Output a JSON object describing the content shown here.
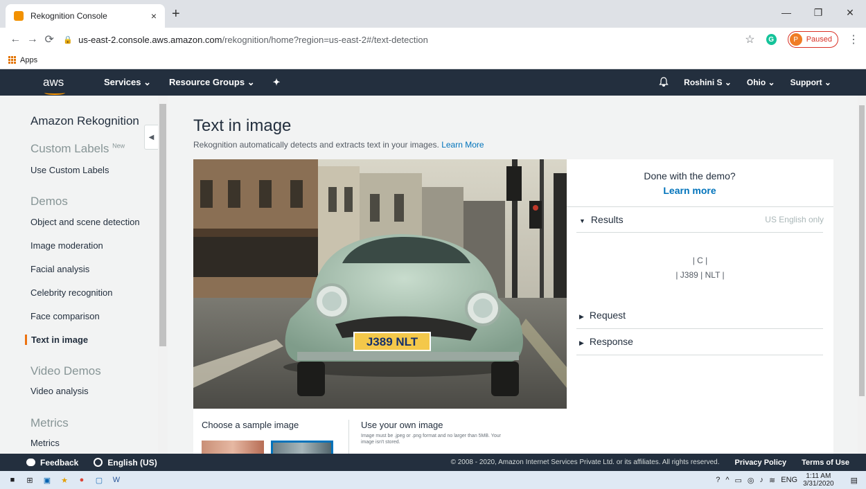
{
  "browser": {
    "tab_title": "Rekognition Console",
    "tab_close": "×",
    "new_tab": "+",
    "url_host": "us-east-2.console.aws.amazon.com",
    "url_path": "/rekognition/home?region=us-east-2#/text-detection",
    "profile_initial": "P",
    "profile_status": "Paused",
    "bookmark_apps": "Apps",
    "grammarly_letter": "G"
  },
  "aws_nav": {
    "logo": "aws",
    "services": "Services ⌄",
    "resource_groups": "Resource Groups ⌄",
    "pin": "✦",
    "bell": "🔔",
    "user": "Roshini S ⌄",
    "region": "Ohio ⌄",
    "support": "Support ⌄"
  },
  "sidebar": {
    "title": "Amazon Rekognition",
    "custom_labels_header": "Custom Labels",
    "new_badge": "New",
    "use_custom_labels": "Use Custom Labels",
    "demos_header": "Demos",
    "demos": [
      "Object and scene detection",
      "Image moderation",
      "Facial analysis",
      "Celebrity recognition",
      "Face comparison",
      "Text in image"
    ],
    "video_demos_header": "Video Demos",
    "video_analysis": "Video analysis",
    "metrics_header": "Metrics",
    "metrics": "Metrics"
  },
  "main": {
    "title": "Text in image",
    "subtitle": "Rekognition automatically detects and extracts text in your images.",
    "learn_more_link": "Learn More",
    "plate_text": "J389 NLT",
    "sample_header": "Choose a sample image",
    "own_image_header": "Use your own image",
    "own_image_note": "Image must be .jpeg or .png format and no larger than 5MB. Your image isn't stored."
  },
  "results": {
    "done_text": "Done with the demo?",
    "learn_more": "Learn more",
    "results_label": "Results",
    "results_note": "US English only",
    "detected_line1": "| C |",
    "detected_line2": "| J389 | NLT |",
    "request_label": "Request",
    "response_label": "Response"
  },
  "footer": {
    "feedback": "Feedback",
    "language": "English (US)",
    "copyright": "© 2008 - 2020, Amazon Internet Services Private Ltd. or its affiliates. All rights reserved.",
    "privacy": "Privacy Policy",
    "terms": "Terms of Use"
  },
  "taskbar": {
    "lang": "ENG",
    "time": "1:11 AM",
    "date": "3/31/2020"
  },
  "colors": {
    "aws_navy": "#232f3e",
    "aws_orange": "#ec7211",
    "link_blue": "#0073bb"
  }
}
